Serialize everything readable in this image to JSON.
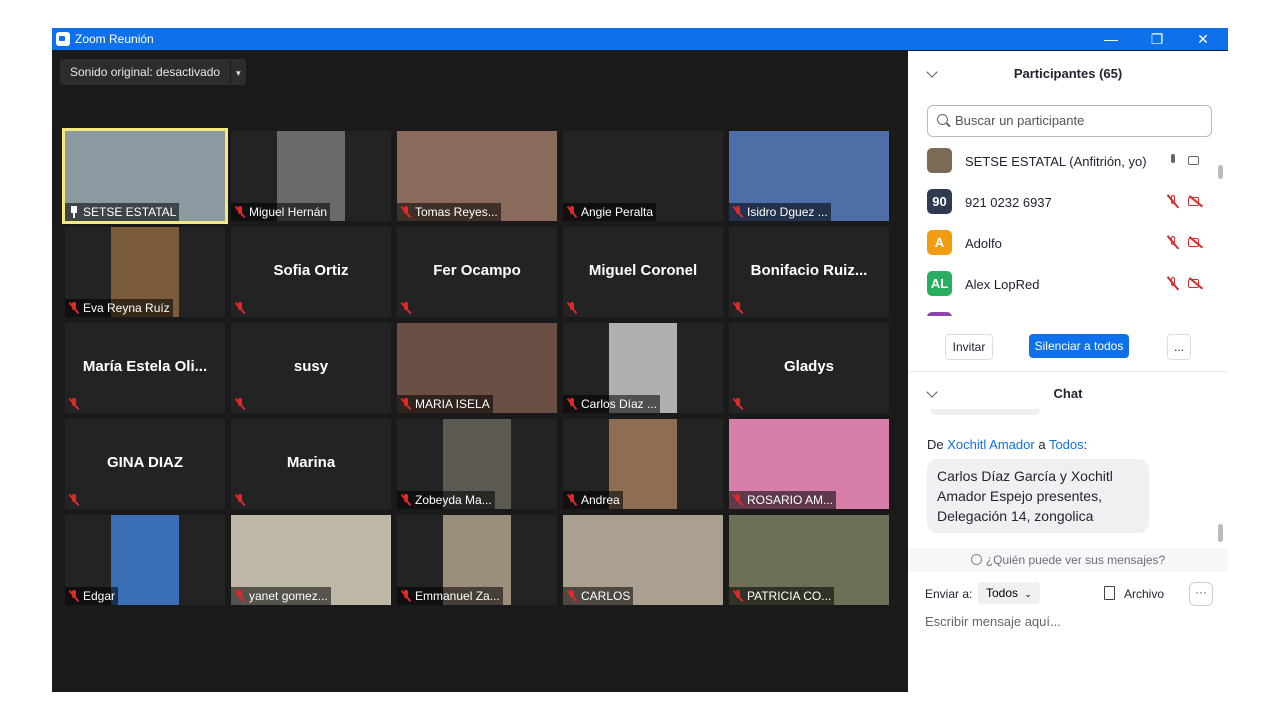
{
  "window": {
    "title": "Zoom Reunión",
    "minimize_label": "—",
    "maximize_label": "❐",
    "close_label": "✕"
  },
  "toolbar": {
    "audio_label": "Sonido original: desactivado",
    "audio_dropdown_label": "▾"
  },
  "tiles": [
    {
      "label": "SETSE ESTATAL",
      "center_name": "",
      "video": "#8a9aa0",
      "active": true,
      "pinned": true
    },
    {
      "label": "Miguel Hernán",
      "center_name": "",
      "video": "#6a6a6a"
    },
    {
      "label": "Tomas Reyes...",
      "center_name": "",
      "video": "#8a6a5a"
    },
    {
      "label": "Angie Peralta",
      "center_name": "",
      "video": ""
    },
    {
      "label": "Isidro Dguez ...",
      "center_name": "",
      "video": "#4e6ea8"
    },
    {
      "label": "Eva Reyna Ruíz",
      "center_name": "",
      "video": "#7a5b3a"
    },
    {
      "label": "",
      "center_name": "Sofia Ortiz",
      "video": ""
    },
    {
      "label": "",
      "center_name": "Fer Ocampo",
      "video": ""
    },
    {
      "label": "",
      "center_name": "Miguel Coronel",
      "video": ""
    },
    {
      "label": "",
      "center_name": "Bonifacio  Ruiz...",
      "video": ""
    },
    {
      "label": "",
      "center_name": "María  Estela  Oli...",
      "video": ""
    },
    {
      "label": "",
      "center_name": "susy",
      "video": ""
    },
    {
      "label": "MARIA ISELA",
      "center_name": "",
      "video": "#6b4e44"
    },
    {
      "label": "Carlos Díaz ...",
      "center_name": "",
      "video": "#b0b0b0"
    },
    {
      "label": "",
      "center_name": "Gladys",
      "video": ""
    },
    {
      "label": "",
      "center_name": "GINA DIAZ",
      "video": ""
    },
    {
      "label": "",
      "center_name": "Marina",
      "video": ""
    },
    {
      "label": "Zobeyda Ma...",
      "center_name": "",
      "video": "#5d5a52"
    },
    {
      "label": "Andrea",
      "center_name": "",
      "video": "#8d6e52"
    },
    {
      "label": "ROSARIO AM...",
      "center_name": "",
      "video": "#d77fa8"
    },
    {
      "label": "Edgar",
      "center_name": "",
      "video": "#3b6fb5"
    },
    {
      "label": "yanet gomez...",
      "center_name": "",
      "video": "#bfb7a8"
    },
    {
      "label": "Emmanuel Za...",
      "center_name": "",
      "video": "#9a8d7a"
    },
    {
      "label": "CARLOS",
      "center_name": "",
      "video": "#aa9f90"
    },
    {
      "label": "PATRICIA CO...",
      "center_name": "",
      "video": "#6d6f56"
    }
  ],
  "participants": {
    "header": "Participantes (65)",
    "search_placeholder": "Buscar un participante",
    "list": [
      {
        "name": "SETSE ESTATAL (Anfitrión, yo)",
        "initials": "",
        "color": "#7a6b55",
        "audio_on": true
      },
      {
        "name": "921 0232 6937",
        "initials": "90",
        "color": "#2f3c4f",
        "audio_on": false
      },
      {
        "name": "Adolfo",
        "initials": "A",
        "color": "#f29c11",
        "audio_on": false
      },
      {
        "name": "Alex LopRed",
        "initials": "AL",
        "color": "#27ae60",
        "audio_on": false
      },
      {
        "name": "",
        "initials": "",
        "color": "#8e44ad",
        "audio_on": false
      }
    ],
    "invite_label": "Invitar",
    "mute_all_label": "Silenciar a todos",
    "more_label": "..."
  },
  "chat": {
    "header": "Chat",
    "from_prefix": "De",
    "sender": "Xochitl Amador",
    "to_word": "a",
    "recipient": "Todos",
    "message": "Carlos Díaz García y Xochitl Amador Espejo presentes, Delegación 14, zongolica",
    "privacy": "¿Quién puede ver sus mensajes?",
    "send_to_label": "Enviar a:",
    "send_to_value": "Todos",
    "file_label": "Archivo",
    "more_label": "···",
    "input_placeholder": "Escribir mensaje aquí..."
  }
}
